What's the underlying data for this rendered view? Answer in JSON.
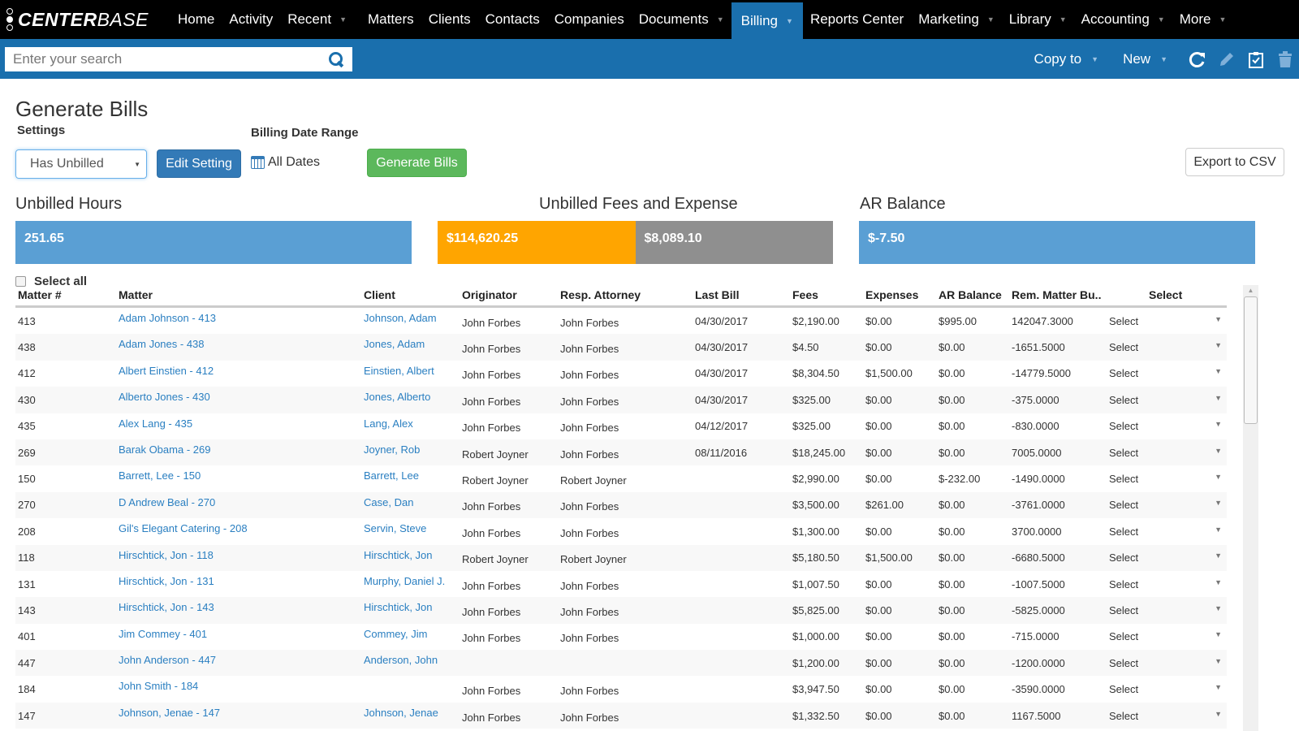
{
  "app": {
    "logo": {
      "bold": "CENTER",
      "light": "BASE"
    }
  },
  "nav": {
    "items": [
      {
        "label": "Home",
        "dropdown": false
      },
      {
        "label": "Activity",
        "dropdown": false
      },
      {
        "label": "Recent",
        "dropdown": true
      },
      {
        "label": "Matters",
        "dropdown": false
      },
      {
        "label": "Clients",
        "dropdown": false
      },
      {
        "label": "Contacts",
        "dropdown": false
      },
      {
        "label": "Companies",
        "dropdown": false
      },
      {
        "label": "Documents",
        "dropdown": true
      },
      {
        "label": "Billing",
        "dropdown": true,
        "active": true
      },
      {
        "label": "Reports Center",
        "dropdown": false
      },
      {
        "label": "Marketing",
        "dropdown": true
      },
      {
        "label": "Library",
        "dropdown": true
      },
      {
        "label": "Accounting",
        "dropdown": true
      },
      {
        "label": "More",
        "dropdown": true
      }
    ],
    "caret": "▼"
  },
  "toolbar": {
    "search_placeholder": "Enter your search",
    "copy_to": "Copy to",
    "new": "New",
    "icons": [
      "refresh-icon",
      "edit-pencil-icon",
      "clipboard-check-icon",
      "trash-icon"
    ]
  },
  "page": {
    "title": "Generate Bills",
    "settings_label": "Settings",
    "settings_value": "Has Unbilled",
    "edit_setting": "Edit Setting",
    "billing_date_range_label": "Billing Date Range",
    "billing_date_range_value": "All Dates",
    "generate_bills": "Generate Bills",
    "export_csv": "Export to CSV"
  },
  "stats": {
    "unbilled_hours": {
      "title": "Unbilled Hours",
      "value": "251.65"
    },
    "unbilled_fees_expense": {
      "title": "Unbilled Fees and Expense",
      "fees": "$114,620.25",
      "expense": "$8,089.10"
    },
    "ar_balance": {
      "title": "AR Balance",
      "value": "$-7.50"
    },
    "colors": {
      "hours": "#5a9fd4",
      "fees": "#ffa500",
      "expense": "#8f8f8f",
      "ar": "#5a9fd4"
    }
  },
  "table": {
    "select_all": "Select all",
    "columns": [
      "Matter #",
      "Matter",
      "Client",
      "Originator",
      "Resp. Attorney",
      "Last Bill",
      "Fees",
      "Expenses",
      "AR Balance",
      "Rem. Matter Bu..",
      "Select"
    ],
    "rows": [
      {
        "num": "413",
        "matter": "Adam Johnson - 413",
        "client": "Johnson, Adam",
        "originator": "John Forbes",
        "resp": "John Forbes",
        "last_bill": "04/30/2017",
        "fees": "$2,190.00",
        "expenses": "$0.00",
        "ar": "$995.00",
        "rem": "142047.3000",
        "select": "Select"
      },
      {
        "num": "438",
        "matter": "Adam Jones - 438",
        "client": "Jones, Adam",
        "originator": "John Forbes",
        "resp": "John Forbes",
        "last_bill": "04/30/2017",
        "fees": "$4.50",
        "expenses": "$0.00",
        "ar": "$0.00",
        "rem": "-1651.5000",
        "select": "Select"
      },
      {
        "num": "412",
        "matter": "Albert Einstien - 412",
        "client": "Einstien, Albert",
        "originator": "John Forbes",
        "resp": "John Forbes",
        "last_bill": "04/30/2017",
        "fees": "$8,304.50",
        "expenses": "$1,500.00",
        "ar": "$0.00",
        "rem": "-14779.5000",
        "select": "Select"
      },
      {
        "num": "430",
        "matter": "Alberto Jones - 430",
        "client": "Jones, Alberto",
        "originator": "John Forbes",
        "resp": "John Forbes",
        "last_bill": "04/30/2017",
        "fees": "$325.00",
        "expenses": "$0.00",
        "ar": "$0.00",
        "rem": "-375.0000",
        "select": "Select"
      },
      {
        "num": "435",
        "matter": "Alex Lang - 435",
        "client": "Lang, Alex",
        "originator": "John Forbes",
        "resp": "John Forbes",
        "last_bill": "04/12/2017",
        "fees": "$325.00",
        "expenses": "$0.00",
        "ar": "$0.00",
        "rem": "-830.0000",
        "select": "Select"
      },
      {
        "num": "269",
        "matter": "Barak Obama - 269",
        "client": "Joyner, Rob",
        "originator": "Robert Joyner",
        "resp": "John Forbes",
        "last_bill": "08/11/2016",
        "fees": "$18,245.00",
        "expenses": "$0.00",
        "ar": "$0.00",
        "rem": "7005.0000",
        "select": "Select"
      },
      {
        "num": "150",
        "matter": "Barrett, Lee - 150",
        "client": "Barrett, Lee",
        "originator": "Robert Joyner",
        "resp": "Robert Joyner",
        "last_bill": "",
        "fees": "$2,990.00",
        "expenses": "$0.00",
        "ar": "$-232.00",
        "rem": "-1490.0000",
        "select": "Select"
      },
      {
        "num": "270",
        "matter": "D Andrew Beal - 270",
        "client": "Case, Dan",
        "originator": "John Forbes",
        "resp": "John Forbes",
        "last_bill": "",
        "fees": "$3,500.00",
        "expenses": "$261.00",
        "ar": "$0.00",
        "rem": "-3761.0000",
        "select": "Select"
      },
      {
        "num": "208",
        "matter": "Gil's Elegant Catering - 208",
        "client": "Servin, Steve",
        "originator": "John Forbes",
        "resp": "John Forbes",
        "last_bill": "",
        "fees": "$1,300.00",
        "expenses": "$0.00",
        "ar": "$0.00",
        "rem": "3700.0000",
        "select": "Select"
      },
      {
        "num": "118",
        "matter": "Hirschtick, Jon - 118",
        "client": "Hirschtick, Jon",
        "originator": "Robert Joyner",
        "resp": "Robert Joyner",
        "last_bill": "",
        "fees": "$5,180.50",
        "expenses": "$1,500.00",
        "ar": "$0.00",
        "rem": "-6680.5000",
        "select": "Select"
      },
      {
        "num": "131",
        "matter": "Hirschtick, Jon - 131",
        "client": "Murphy, Daniel J.",
        "originator": "John Forbes",
        "resp": "John Forbes",
        "last_bill": "",
        "fees": "$1,007.50",
        "expenses": "$0.00",
        "ar": "$0.00",
        "rem": "-1007.5000",
        "select": "Select"
      },
      {
        "num": "143",
        "matter": "Hirschtick, Jon - 143",
        "client": "Hirschtick, Jon",
        "originator": "John Forbes",
        "resp": "John Forbes",
        "last_bill": "",
        "fees": "$5,825.00",
        "expenses": "$0.00",
        "ar": "$0.00",
        "rem": "-5825.0000",
        "select": "Select"
      },
      {
        "num": "401",
        "matter": "Jim Commey - 401",
        "client": "Commey, Jim",
        "originator": "John Forbes",
        "resp": "John Forbes",
        "last_bill": "",
        "fees": "$1,000.00",
        "expenses": "$0.00",
        "ar": "$0.00",
        "rem": "-715.0000",
        "select": "Select"
      },
      {
        "num": "447",
        "matter": "John Anderson - 447",
        "client": "Anderson, John",
        "originator": "",
        "resp": "",
        "last_bill": "",
        "fees": "$1,200.00",
        "expenses": "$0.00",
        "ar": "$0.00",
        "rem": "-1200.0000",
        "select": "Select"
      },
      {
        "num": "184",
        "matter": "John Smith - 184",
        "client": "",
        "originator": "John Forbes",
        "resp": "John Forbes",
        "last_bill": "",
        "fees": "$3,947.50",
        "expenses": "$0.00",
        "ar": "$0.00",
        "rem": "-3590.0000",
        "select": "Select"
      },
      {
        "num": "147",
        "matter": "Johnson, Jenae - 147",
        "client": "Johnson, Jenae",
        "originator": "John Forbes",
        "resp": "John Forbes",
        "last_bill": "",
        "fees": "$1,332.50",
        "expenses": "$0.00",
        "ar": "$0.00",
        "rem": "1167.5000",
        "select": "Select"
      }
    ]
  }
}
